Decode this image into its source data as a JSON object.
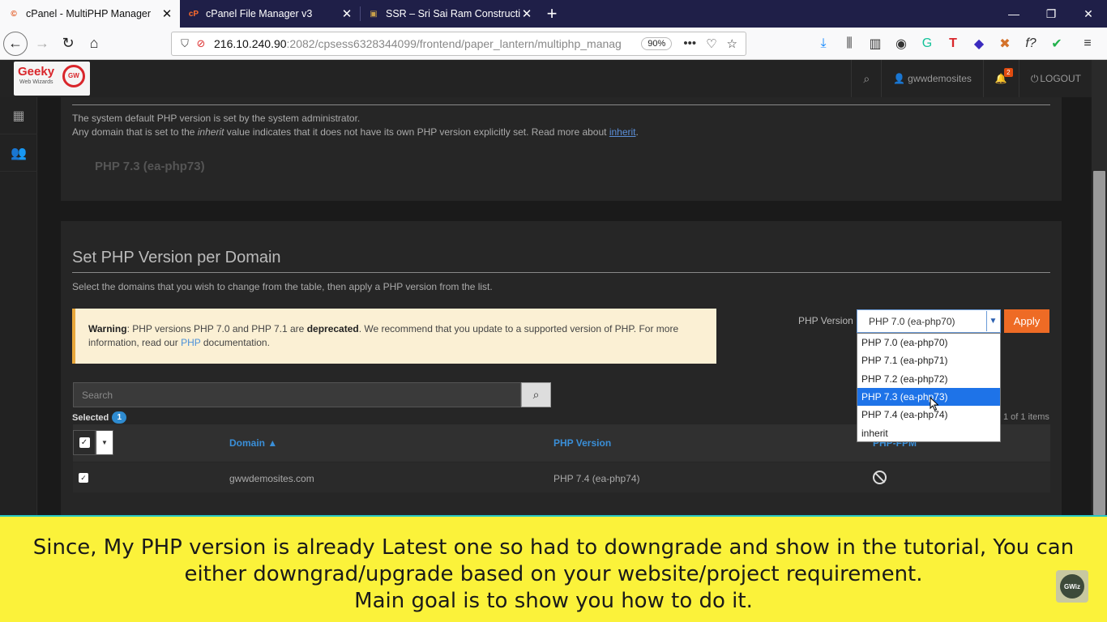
{
  "browser": {
    "tabs": [
      {
        "title": "cPanel - MultiPHP Manager",
        "active": true
      },
      {
        "title": "cPanel File Manager v3",
        "active": false
      },
      {
        "title": "SSR – Sri Sai Ram Constructions",
        "active": false
      }
    ],
    "url_host": "216.10.240.90",
    "url_rest": ":2082/cpsess6328344099/frontend/paper_lantern/multiphp_manag",
    "zoom": "90%"
  },
  "header": {
    "logo_title": "Geeky",
    "logo_sub": "Web Wizards",
    "username": "gwwdemosites",
    "notifications": "2",
    "logout": "LOGOUT"
  },
  "system_panel": {
    "line1": "The system default PHP version is set by the system administrator.",
    "line2_pre": "Any domain that is set to the ",
    "line2_em": "inherit",
    "line2_mid": " value indicates that it does not have its own PHP version explicitly set. Read more about ",
    "line2_link": "inherit",
    "line2_end": ".",
    "system_version": "PHP 7.3 (ea-php73)"
  },
  "domain_panel": {
    "title": "Set PHP Version per Domain",
    "description": "Select the domains that you wish to change from the table, then apply a PHP version from the list.",
    "warning_label": "Warning",
    "warning_pre": ": PHP versions PHP 7.0 and PHP 7.1 are ",
    "warning_bold": "deprecated",
    "warning_mid": ". We recommend that you update to a supported version of PHP. For more information, read our ",
    "warning_link": "PHP",
    "warning_end": " documentation.",
    "php_version_label": "PHP Version",
    "selected_version": "PHP 7.0 (ea-php70)",
    "apply_label": "Apply",
    "options": [
      "PHP 7.0 (ea-php70)",
      "PHP 7.1 (ea-php71)",
      "PHP 7.2 (ea-php72)",
      "PHP 7.3 (ea-php73)",
      "PHP 7.4 (ea-php74)",
      "inherit"
    ],
    "highlighted_option": "PHP 7.3 (ea-php73)",
    "search_placeholder": "Search",
    "selected_label": "Selected",
    "selected_count": "1",
    "pager_text": "1 of 1 items",
    "columns": {
      "domain": "Domain ▲",
      "php_version": "PHP Version",
      "php_fpm": "PHP-FPM"
    },
    "rows": [
      {
        "domain": "gwwdemosites.com",
        "php_version": "PHP 7.4 (ea-php74)"
      }
    ]
  },
  "caption": {
    "line1": "Since, My PHP version is already Latest one so had to downgrade and show in the tutorial, You can",
    "line2": "either downgrad/upgrade based on your website/project requirement.",
    "line3": "Main goal is to show you how to do it.",
    "watermark": "GWiz"
  }
}
